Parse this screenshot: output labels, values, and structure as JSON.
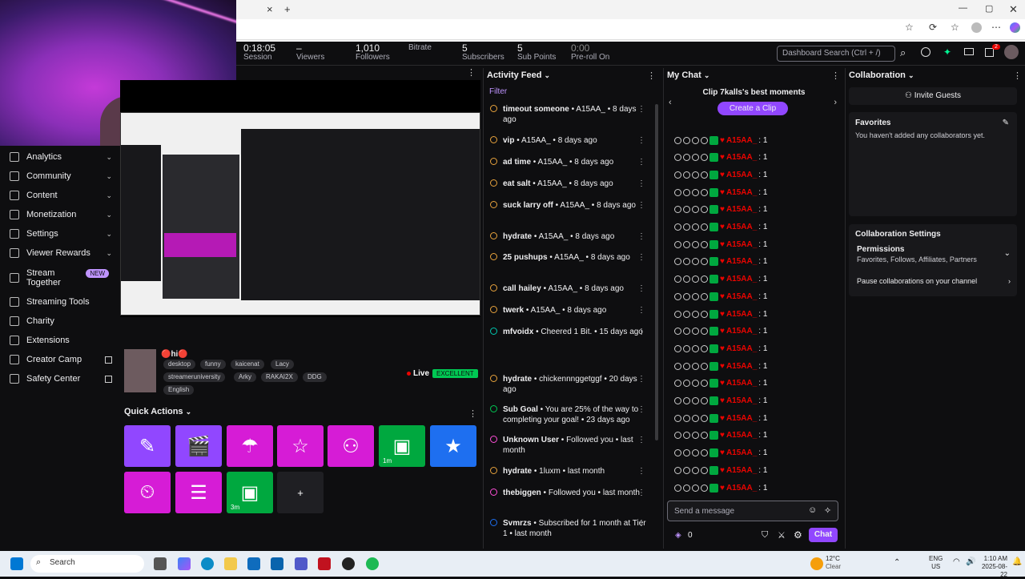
{
  "browser": {
    "new_tab": "+",
    "close_tab": "×"
  },
  "topbar": {
    "stats": [
      {
        "value": "0:18:05",
        "label": "Session"
      },
      {
        "value": "–",
        "label": "Viewers"
      },
      {
        "value": "1,010",
        "label": "Followers"
      },
      {
        "value": "",
        "label": "Bitrate"
      },
      {
        "value": "5",
        "label": "Subscribers"
      },
      {
        "value": "5",
        "label": "Sub Points"
      },
      {
        "value": "0:00",
        "label": "Pre-roll On"
      }
    ],
    "search_placeholder": "Dashboard Search (Ctrl + /)",
    "notif_count": "2"
  },
  "sidebar": {
    "items": [
      {
        "label": "Analytics"
      },
      {
        "label": "Community"
      },
      {
        "label": "Content"
      },
      {
        "label": "Monetization"
      },
      {
        "label": "Settings"
      },
      {
        "label": "Viewer Rewards"
      },
      {
        "label": "Stream Together",
        "badge": "NEW"
      },
      {
        "label": "Streaming Tools"
      },
      {
        "label": "Charity"
      },
      {
        "label": "Extensions"
      },
      {
        "label": "Creator Camp"
      },
      {
        "label": "Safety Center"
      }
    ]
  },
  "stream": {
    "title": "🔴hi🔴",
    "tags": [
      "desktop",
      "funny",
      "kaicenat",
      "Lacy",
      "streameruniversity",
      "Arky",
      "RAKAI2X",
      "DDG",
      "English"
    ],
    "live": "Live",
    "quality": "EXCELLENT"
  },
  "quick_actions": {
    "title": "Quick Actions",
    "timer1": "1m",
    "timer2": "3m",
    "add": "+"
  },
  "activity": {
    "title": "Activity Feed",
    "filter": "Filter",
    "items": [
      {
        "name": "timeout someone",
        "meta": " • A15AA_ • 8 days ago"
      },
      {
        "name": "vip",
        "meta": " • A15AA_ • 8 days ago"
      },
      {
        "name": "ad time",
        "meta": " • A15AA_ • 8 days ago"
      },
      {
        "name": "eat salt",
        "meta": " • A15AA_ • 8 days ago"
      },
      {
        "name": "suck larry off",
        "meta": " • A15AA_ • 8 days ago"
      },
      {
        "name": "hydrate",
        "meta": " • A15AA_ • 8 days ago"
      },
      {
        "name": "25 pushups",
        "meta": " • A15AA_ • 8 days ago"
      },
      {
        "name": "call hailey",
        "meta": " • A15AA_ • 8 days ago"
      },
      {
        "name": "twerk",
        "meta": " • A15AA_ • 8 days ago"
      },
      {
        "name": "mfvoidx",
        "meta": " • Cheered 1 Bit. • 15 days ago"
      },
      {
        "name": "hydrate",
        "meta": " • chickennnggetggf • 20 days ago"
      },
      {
        "name": "Sub Goal",
        "meta": " • You are 25% of the way to completing your goal! • 23 days ago"
      },
      {
        "name": "Unknown User",
        "meta": " • Followed you • last month"
      },
      {
        "name": "hydrate",
        "meta": " • 1luxm • last month"
      },
      {
        "name": "thebiggen",
        "meta": " • Followed you • last month"
      },
      {
        "name": "Svmrzs",
        "meta": " • Subscribed for 1 month at Tier 1 • last month"
      }
    ]
  },
  "chat": {
    "title": "My Chat",
    "clip_title": "Clip 7kalls's best moments",
    "create_clip": "Create a Clip",
    "username": "A15AA_",
    "message": ": 1",
    "input_placeholder": "Send a message",
    "points": "0",
    "send": "Chat"
  },
  "collab": {
    "title": "Collaboration",
    "invite": "Invite Guests",
    "favorites_title": "Favorites",
    "favorites_text": "You haven't added any collaborators yet.",
    "settings_title": "Collaboration Settings",
    "permissions_title": "Permissions",
    "permissions_sub": "Favorites, Follows, Affiliates, Partners",
    "pause": "Pause collaborations on your channel"
  },
  "taskbar": {
    "search": "Search",
    "temp": "12°C",
    "weather": "Clear",
    "lang1": "ENG",
    "lang2": "US",
    "time": "1:10 AM",
    "date": "2025-08-22"
  },
  "colors": {
    "purple": "#9147ff",
    "magenta": "#d61cd6",
    "green": "#00a83f",
    "blue": "#1e6ff0"
  }
}
